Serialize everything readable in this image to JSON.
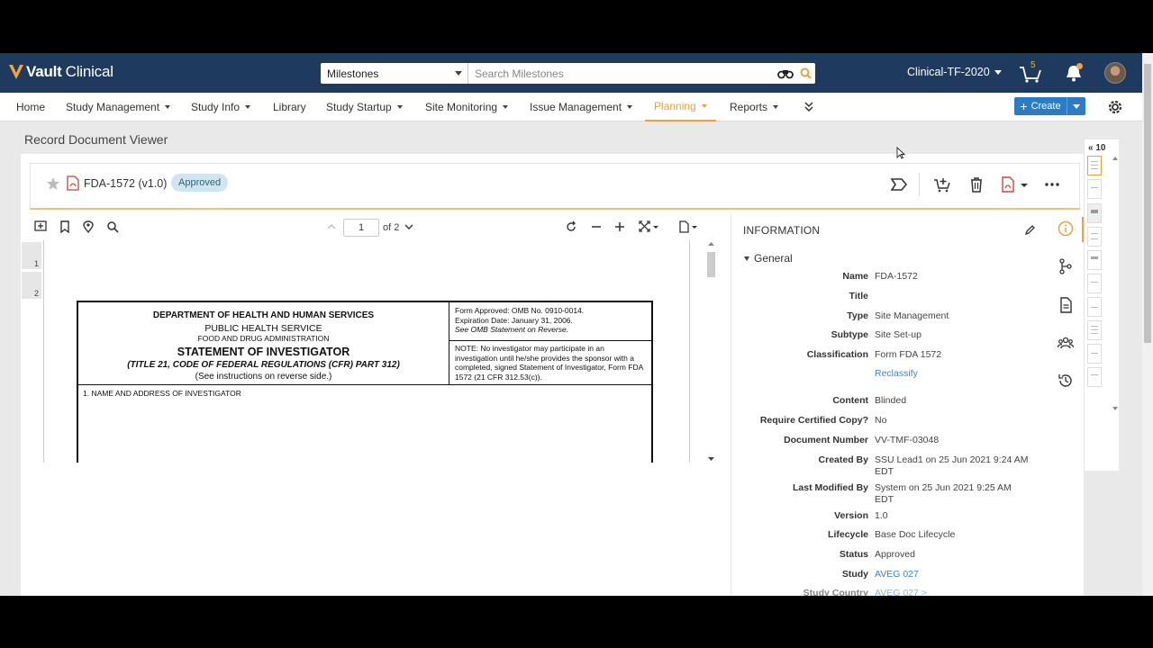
{
  "header": {
    "logo_text_a": "Vault",
    "logo_text_b": "Clinical",
    "search_scope": "Milestones",
    "search_placeholder": "Search Milestones",
    "vault_name": "Clinical-TF-2020",
    "cart_count": "5",
    "brand_color": "#1f3a5f",
    "accent_color": "#e8a33b"
  },
  "nav": {
    "items": [
      {
        "label": "Home",
        "dropdown": false
      },
      {
        "label": "Study Management",
        "dropdown": true
      },
      {
        "label": "Study Info",
        "dropdown": true
      },
      {
        "label": "Library",
        "dropdown": false
      },
      {
        "label": "Study Startup",
        "dropdown": true
      },
      {
        "label": "Site Monitoring",
        "dropdown": true
      },
      {
        "label": "Issue Management",
        "dropdown": true
      },
      {
        "label": "Planning",
        "dropdown": true,
        "active": true
      },
      {
        "label": "Reports",
        "dropdown": true
      }
    ],
    "create_label": "Create"
  },
  "page": {
    "title": "Record Document Viewer"
  },
  "document": {
    "name": "FDA-1572 (v1.0)",
    "status_badge": "Approved",
    "page_current": "1",
    "page_total_label": "of 2",
    "page_numbers": [
      "1",
      "2"
    ],
    "form": {
      "dept": "DEPARTMENT OF HEALTH AND HUMAN SERVICES",
      "service": "PUBLIC HEALTH SERVICE",
      "agency": "FOOD AND DRUG ADMINISTRATION",
      "heading": "STATEMENT OF INVESTIGATOR",
      "subheading": "(TITLE 21, CODE OF FEDERAL REGULATIONS (CFR) PART 312)",
      "instructions": "(See instructions on reverse side.)",
      "omb_line1": "Form Approved: OMB No. 0910-0014.",
      "omb_line2": "Expiration Date: January 31, 2006.",
      "omb_line3": "See OMB Statement on Reverse.",
      "note": "NOTE: No investigator may participate in an investigation until he/she provides the sponsor with a completed, signed Statement of Investigator, Form FDA 1572 (21 CFR 312.53(c)).",
      "section1": "1.   NAME AND ADDRESS OF INVESTIGATOR"
    }
  },
  "info": {
    "title": "INFORMATION",
    "section": "General",
    "fields": [
      {
        "label": "Name",
        "value": "FDA-1572"
      },
      {
        "label": "Title",
        "value": ""
      },
      {
        "label": "Type",
        "value": "Site Management"
      },
      {
        "label": "Subtype",
        "value": "Site Set-up"
      },
      {
        "label": "Classification",
        "value": "Form FDA 1572"
      },
      {
        "label": "",
        "value": "Reclassify",
        "link": true
      },
      {
        "label": "Content",
        "value": "Blinded"
      },
      {
        "label": "Require Certified Copy?",
        "value": "No"
      },
      {
        "label": "Document Number",
        "value": "VV-TMF-03048"
      },
      {
        "label": "Created By",
        "value": "SSU Lead1 on 25 Jun 2021 9:24 AM EDT"
      },
      {
        "label": "Last Modified By",
        "value": "System on 25 Jun 2021 9:25 AM EDT"
      },
      {
        "label": "Version",
        "value": "1.0"
      },
      {
        "label": "Lifecycle",
        "value": "Base Doc Lifecycle"
      },
      {
        "label": "Status",
        "value": "Approved"
      },
      {
        "label": "Study",
        "value": "AVEG 027",
        "link": true
      },
      {
        "label": "Study Country",
        "value": "AVEG 027 >",
        "link": true
      }
    ]
  },
  "thumbs": {
    "count_label": "10"
  }
}
